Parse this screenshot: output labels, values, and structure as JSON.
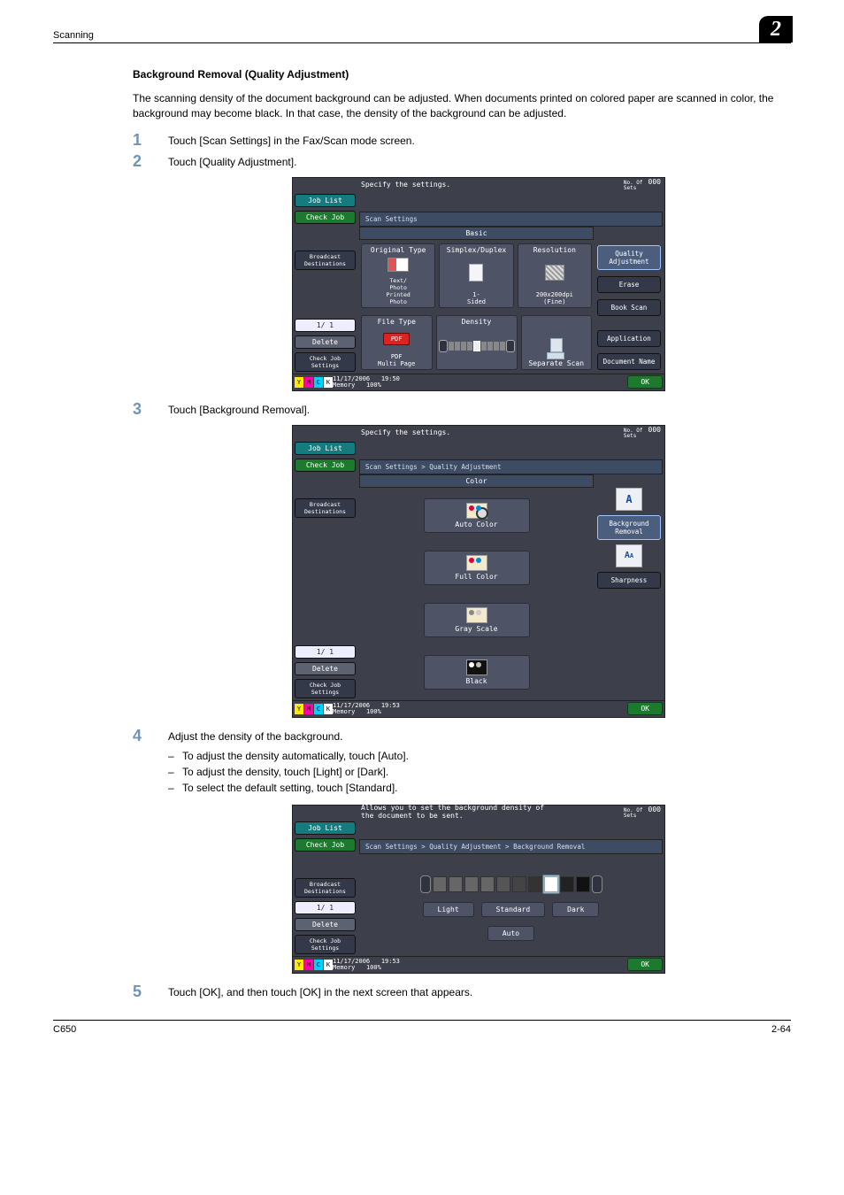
{
  "header": {
    "section": "Scanning",
    "chapter": "2"
  },
  "body": {
    "title": "Background Removal (Quality Adjustment)",
    "intro": "The scanning density of the document background can be adjusted. When documents printed on colored paper are scanned in color, the background may become black. In that case, the density of the background can be adjusted.",
    "steps": {
      "s1": {
        "num": "1",
        "text": "Touch [Scan Settings] in the Fax/Scan mode screen."
      },
      "s2": {
        "num": "2",
        "text": "Touch [Quality Adjustment]."
      },
      "s3": {
        "num": "3",
        "text": "Touch [Background Removal]."
      },
      "s4": {
        "num": "4",
        "text": "Adjust the density of the background.",
        "sub": {
          "a": "To adjust the density automatically, touch [Auto].",
          "b": "To adjust the density, touch [Light] or [Dark].",
          "c": "To select the default setting, touch [Standard]."
        }
      },
      "s5": {
        "num": "5",
        "text": "Touch [OK], and then touch [OK] in the next screen that appears."
      }
    }
  },
  "common": {
    "job_list": "Job List",
    "check_job": "Check Job",
    "broadcast": "Broadcast\nDestinations",
    "page_ind": "1/   1",
    "delete": "Delete",
    "check_settings": "Check Job\nSettings",
    "ok": "OK",
    "nosets": "No. Of\nSets",
    "nosets_val": "000",
    "memory": "Memory",
    "memory_val": "100%"
  },
  "shot1": {
    "prompt": "Specify the settings.",
    "breadcrumb": "Scan Settings",
    "tab": "Basic",
    "col": {
      "orig": "Original Type",
      "orig_sub": "Text/\nPhoto\nPrinted\nPhoto",
      "duplex": "Simplex/Duplex",
      "duplex_sub": "1-\nSided",
      "res": "Resolution",
      "res_sub": "200x200dpi\n(Fine)",
      "ftype": "File Type",
      "ftype_lbl": "PDF",
      "ftype_sub": "PDF\nMulti Page",
      "density": "Density",
      "sep": "Separate Scan"
    },
    "right": {
      "qa": "Quality\nAdjustment",
      "erase": "Erase",
      "book": "Book Scan",
      "app": "Application",
      "doc": "Document Name"
    },
    "ts": {
      "date": "11/17/2006",
      "time": "19:50"
    }
  },
  "shot2": {
    "prompt": "Specify the settings.",
    "breadcrumb": "Scan Settings > Quality Adjustment",
    "tab": "Color",
    "btns": {
      "auto": "Auto Color",
      "full": "Full Color",
      "gray": "Gray Scale",
      "black": "Black"
    },
    "right": {
      "bg": "Background\nRemoval",
      "sharp": "Sharpness"
    },
    "ts": {
      "date": "11/17/2006",
      "time": "19:53"
    }
  },
  "shot3": {
    "prompt": "Allows you to set the background density of\nthe document to be sent.",
    "breadcrumb": "Scan Settings > Quality Adjustment > Background Removal",
    "btns": {
      "light": "Light",
      "standard": "Standard",
      "dark": "Dark",
      "auto": "Auto"
    },
    "ts": {
      "date": "11/17/2006",
      "time": "19:53"
    }
  },
  "footer": {
    "left": "C650",
    "right": "2-64"
  }
}
